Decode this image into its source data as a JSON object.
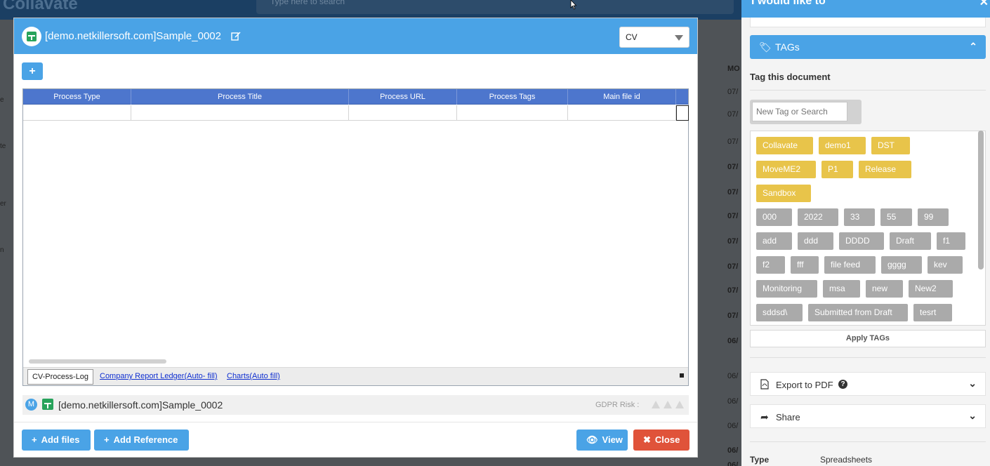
{
  "background": {
    "app_name": "Collavate",
    "search_placeholder": "Type here to search",
    "column_header": "MO",
    "left_fragments": [
      "e",
      "te",
      "er",
      "n"
    ],
    "dates": [
      "07/",
      "07/",
      "07/",
      "07/",
      "07/",
      "07/",
      "07/",
      "07/",
      "07/",
      "07/",
      "06/",
      "06/",
      "06/",
      "06/",
      "06/",
      "06/"
    ]
  },
  "modal": {
    "title": "[demo.netkillersoft.com]Sample_0002",
    "doc_type": "CV",
    "add_button": "+",
    "grid": {
      "columns": [
        "Process Type",
        "Process Title",
        "Process URL",
        "Process Tags",
        "Main file id"
      ]
    },
    "sheet_tabs": {
      "active": "CV-Process-Log",
      "others": [
        "Company Report Ledger(Auto- fill)",
        "Charts(Auto fill)"
      ]
    },
    "file": {
      "badge": "M",
      "name": "[demo.netkillersoft.com]Sample_0002",
      "gdpr_label": "GDPR Risk :"
    },
    "buttons": {
      "add_files": "Add files",
      "add_reference": "Add Reference",
      "view": "View",
      "close": "Close"
    }
  },
  "panel": {
    "title": "I would like to",
    "tags_header": "TAGs",
    "tag_doc_title": "Tag this document",
    "tag_input_placeholder": "New Tag or Search",
    "applied_tags": [
      "Collavate",
      "demo1",
      "DST",
      "MoveME2",
      "P1",
      "Release",
      "Sandbox"
    ],
    "available_tags": [
      "000",
      "2022",
      "33",
      "55",
      "99",
      "add",
      "ddd",
      "DDDD",
      "Draft",
      "f1",
      "f2",
      "fff",
      "file feed",
      "gggg",
      "kev",
      "Monitoring",
      "msa",
      "new",
      "New2",
      "sddsd\\",
      "Submitted from Draft",
      "tesrt"
    ],
    "apply_button": "Apply TAGs",
    "export_pdf": "Export to PDF",
    "help_icon": "?",
    "share": "Share",
    "type_label": "Type",
    "type_value": "Spreadsheets"
  },
  "colors": {
    "accent": "#4aa3e6",
    "grid_header": "#4d76cd",
    "applied_tag": "#e8c44a",
    "available_tag": "#aaaaaa",
    "close_button": "#e0533a",
    "sheet_icon": "#27a35b"
  }
}
